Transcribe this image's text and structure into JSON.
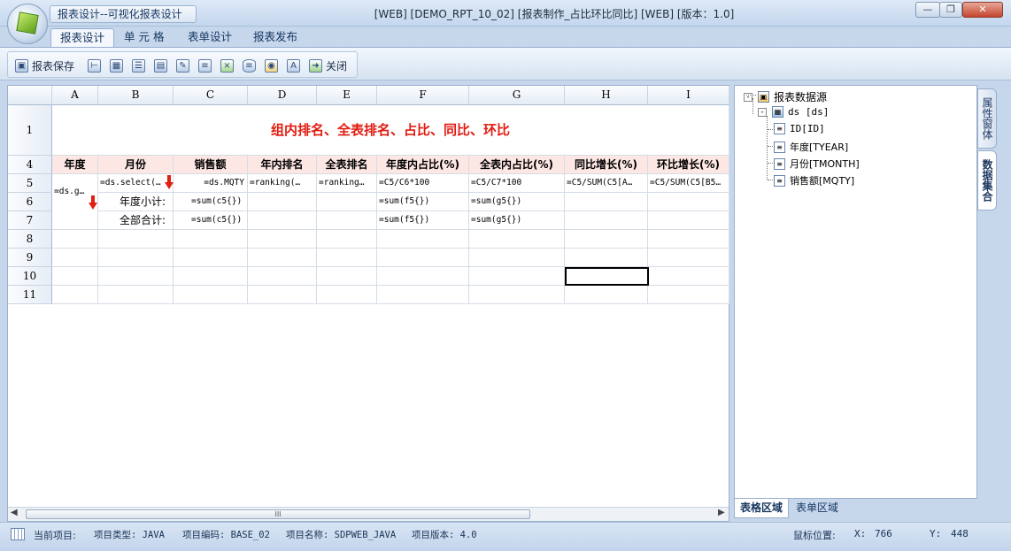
{
  "app": {
    "quick_access_title": "报表设计--可视化报表设计",
    "window_title": "[WEB] [DEMO_RPT_10_02] [报表制作_占比环比同比] [WEB] [版本：1.0]"
  },
  "ribbon": {
    "tabs": [
      {
        "label": "报表设计",
        "active": true
      },
      {
        "label": "单 元 格"
      },
      {
        "label": "表单设计"
      },
      {
        "label": "报表发布"
      }
    ]
  },
  "toolbar": {
    "save_label": "报表保存",
    "close_label": "关闭",
    "icons": [
      "save-icon",
      "tree-icon",
      "table-icon",
      "properties-icon",
      "form-icon",
      "edit-icon",
      "parameter-icon",
      "excel-icon",
      "database-icon",
      "preview-icon",
      "text-icon",
      "close-icon"
    ]
  },
  "sheet": {
    "columns": [
      "A",
      "B",
      "C",
      "D",
      "E",
      "F",
      "G",
      "H",
      "I"
    ],
    "rows": [
      "1",
      "4",
      "5",
      "6",
      "7",
      "8",
      "9",
      "10",
      "11"
    ],
    "title": "组内排名、全表排名、占比、同比、环比",
    "headers": [
      "年度",
      "月份",
      "销售额",
      "年内排名",
      "全表排名",
      "年度内占比(%)",
      "全表内占比(%)",
      "同比增长(%)",
      "环比增长(%)"
    ],
    "row5": {
      "a": "=ds.g…",
      "b": "=ds.select(…",
      "c": "=ds.MQTY",
      "d": "=ranking(…",
      "e": "=ranking…",
      "f": "=C5/C6*100",
      "g": "=C5/C7*100",
      "h": "=C5/SUM(C5[A…",
      "i": "=C5/SUM(C5[B5…"
    },
    "row6": {
      "b": "年度小计:",
      "c": "=sum(c5{})",
      "f": "=sum(f5{})",
      "g": "=sum(g5{})"
    },
    "row7": {
      "b": "全部合计:",
      "c": "=sum(c5{})",
      "f": "=sum(f5{})",
      "g": "=sum(g5{})"
    },
    "scroll_grip": "III"
  },
  "datasource": {
    "root": "报表数据源",
    "dataset": "ds [ds]",
    "fields": [
      "ID[ID]",
      "年度[TYEAR]",
      "月份[TMONTH]",
      "销售额[MQTY]"
    ]
  },
  "side_tabs": [
    {
      "label": "属性窗体"
    },
    {
      "label": "数据集合",
      "active": true
    }
  ],
  "bottom_tabs": [
    {
      "label": "表格区域",
      "active": true
    },
    {
      "label": "表单区域"
    }
  ],
  "status": {
    "current_project": "当前项目:",
    "project_type": "项目类型: JAVA",
    "project_code": "项目编码: BASE_02",
    "project_name": "项目名称: SDPWEB_JAVA",
    "project_version": "项目版本: 4.0",
    "mouse_label": "鼠标位置:",
    "x_label": "X:",
    "x_value": "766",
    "y_label": "Y:",
    "y_value": "448"
  },
  "colors": {
    "title_red": "#e01b10",
    "header_fill": "#fde7e4",
    "frame_blue": "#c6d7ec"
  }
}
